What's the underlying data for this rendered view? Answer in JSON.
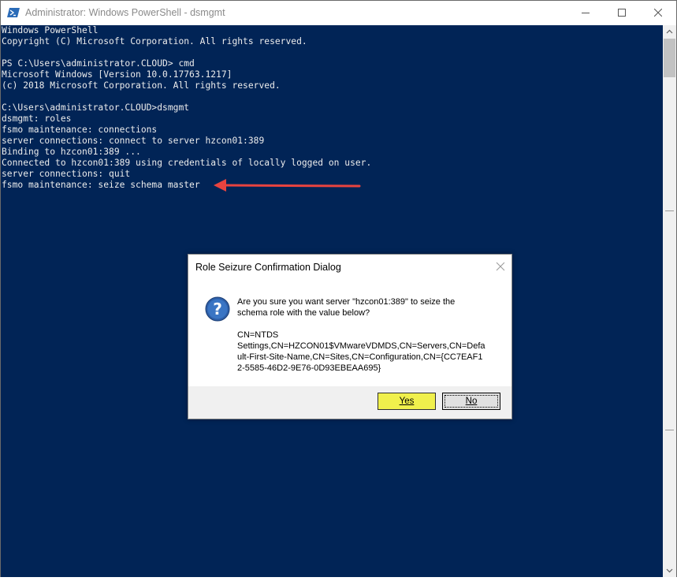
{
  "window": {
    "title": "Administrator: Windows PowerShell - dsmgmt",
    "controls": [
      "minimize-icon",
      "maximize-icon",
      "close-icon"
    ]
  },
  "console": {
    "lines": [
      "Windows PowerShell",
      "Copyright (C) Microsoft Corporation. All rights reserved.",
      "",
      "PS C:\\Users\\administrator.CLOUD> cmd",
      "Microsoft Windows [Version 10.0.17763.1217]",
      "(c) 2018 Microsoft Corporation. All rights reserved.",
      "",
      "C:\\Users\\administrator.CLOUD>dsmgmt",
      "dsmgmt: roles",
      "fsmo maintenance: connections",
      "server connections: connect to server hzcon01:389",
      "Binding to hzcon01:389 ...",
      "Connected to hzcon01:389 using credentials of locally logged on user.",
      "server connections: quit",
      "fsmo maintenance: seize schema master"
    ],
    "background_color": "#012456",
    "text_color": "#ececec",
    "annotation_arrow_color": "#e8433f"
  },
  "dialog": {
    "title": "Role Seizure Confirmation Dialog",
    "icon": "question-icon",
    "message_line1": "Are you sure you want server \"hzcon01:389\" to seize the",
    "message_line2": "schema role with the value below?",
    "dn_line1": "CN=NTDS",
    "dn_line2": "Settings,CN=HZCON01$VMwareVDMDS,CN=Servers,CN=Defa",
    "dn_line3": "ult-First-Site-Name,CN=Sites,CN=Configuration,CN={CC7EAF1",
    "dn_line4": "2-5585-46D2-9E76-0D93EBEAA695}",
    "yes_label": "Yes",
    "no_label": "No",
    "yes_color": "#f0f04c"
  }
}
